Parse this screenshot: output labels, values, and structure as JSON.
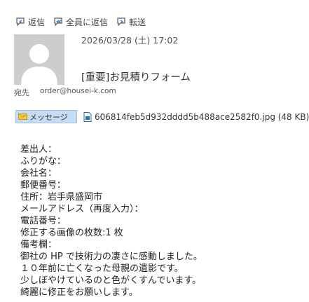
{
  "toolbar": {
    "reply_label": "返信",
    "reply_all_label": "全員に返信",
    "forward_label": "転送"
  },
  "header": {
    "date": "2026/03/28 (土) 17:02",
    "subject": "[重要]お見積りフォーム",
    "to_label": "宛先",
    "to_address": "order@housei-k.com"
  },
  "attachments": {
    "message_tab_label": "メッセージ",
    "file_label": "606814feb5d932dddd5b488ace2582f0.jpg (48 KB)"
  },
  "body": {
    "lines": [
      "差出人：",
      "ふりがな：",
      "会社名：",
      "郵便番号：",
      "住所：岩手県盛岡市",
      "メールアドレス（再度入力）：",
      "電話番号：",
      "修正する画像の枚数:1 枚",
      "備考欄：",
      "御社の HP で技術力の凄さに感動しました。",
      "１０年前に亡くなった母親の遺影です。",
      "少しぼやけているのと色がくすんでいます。",
      "綺麗に修正をお願いします。"
    ]
  },
  "icons": {
    "reply": "reply-icon",
    "reply_all": "reply-all-icon",
    "forward": "forward-icon",
    "avatar": "person-silhouette",
    "message_tab": "envelope-icon",
    "attachment": "image-file-icon"
  },
  "colors": {
    "tab_background": "#c5dcf2",
    "avatar_background": "#cdcdcd",
    "icon_blue": "#2b6cb0"
  }
}
